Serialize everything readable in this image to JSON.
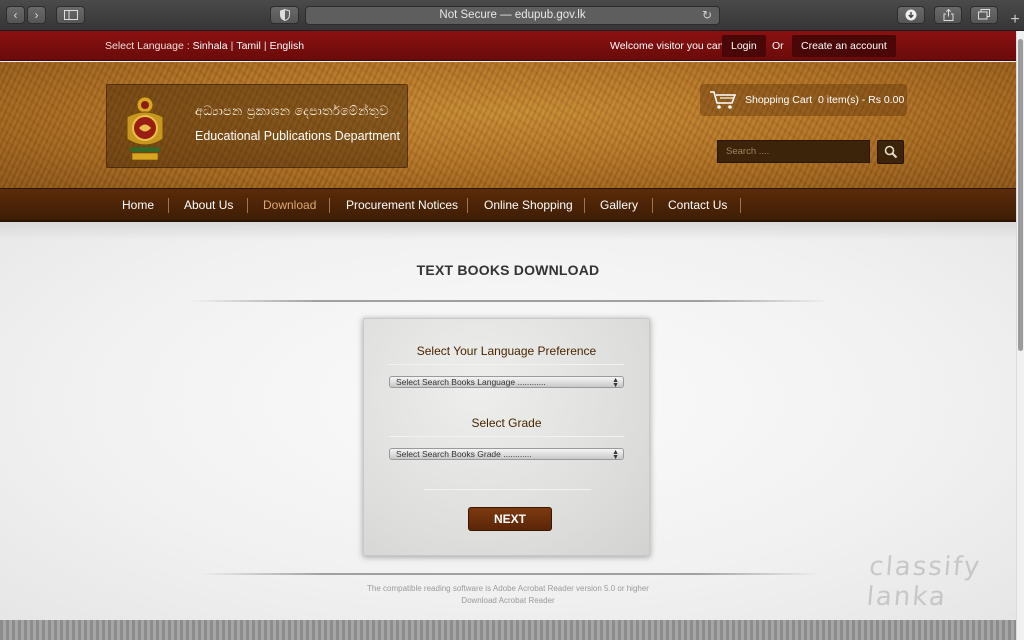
{
  "browser": {
    "url_text": "Not Secure — edupub.gov.lk",
    "back": "‹",
    "forward": "›"
  },
  "topbar": {
    "select_language_label": "Select Language :",
    "languages": [
      "Sinhala",
      "Tamil",
      "English"
    ],
    "separator": "|",
    "welcome": "Welcome visitor you can",
    "login": "Login",
    "or": "Or",
    "create_account": "Create an account"
  },
  "header": {
    "sinhala_title": "අධ්‍යාපන ප්‍රකාශන දෙපාර්තමේන්තුව",
    "english_title": "Educational Publications Department",
    "cart_label": "Shopping Cart",
    "cart_items": "0 item(s) - Rs 0.00",
    "search_placeholder": "Search ...."
  },
  "nav": {
    "items": [
      "Home",
      "About Us",
      "Download",
      "Procurement Notices",
      "Online Shopping",
      "Gallery",
      "Contact Us"
    ],
    "active": "Download"
  },
  "main": {
    "title": "TEXT BOOKS DOWNLOAD",
    "language_label": "Select Your Language Preference",
    "language_select": "Select Search Books Language ............",
    "grade_label": "Select Grade",
    "grade_select": "Select Search Books Grade ............",
    "next": "NEXT",
    "footer_line1": "The compatible reading software is Adobe Acrobat Reader version 5.0 or higher",
    "footer_line2": "Download Acrobat Reader"
  },
  "watermark": "classify lanka",
  "colors": {
    "topbar_red": "#7a0d0d",
    "header_gold": "#b47425",
    "nav_brown": "#4a2207",
    "active_nav": "#e0a873",
    "next_button": "#6a2c0b"
  }
}
